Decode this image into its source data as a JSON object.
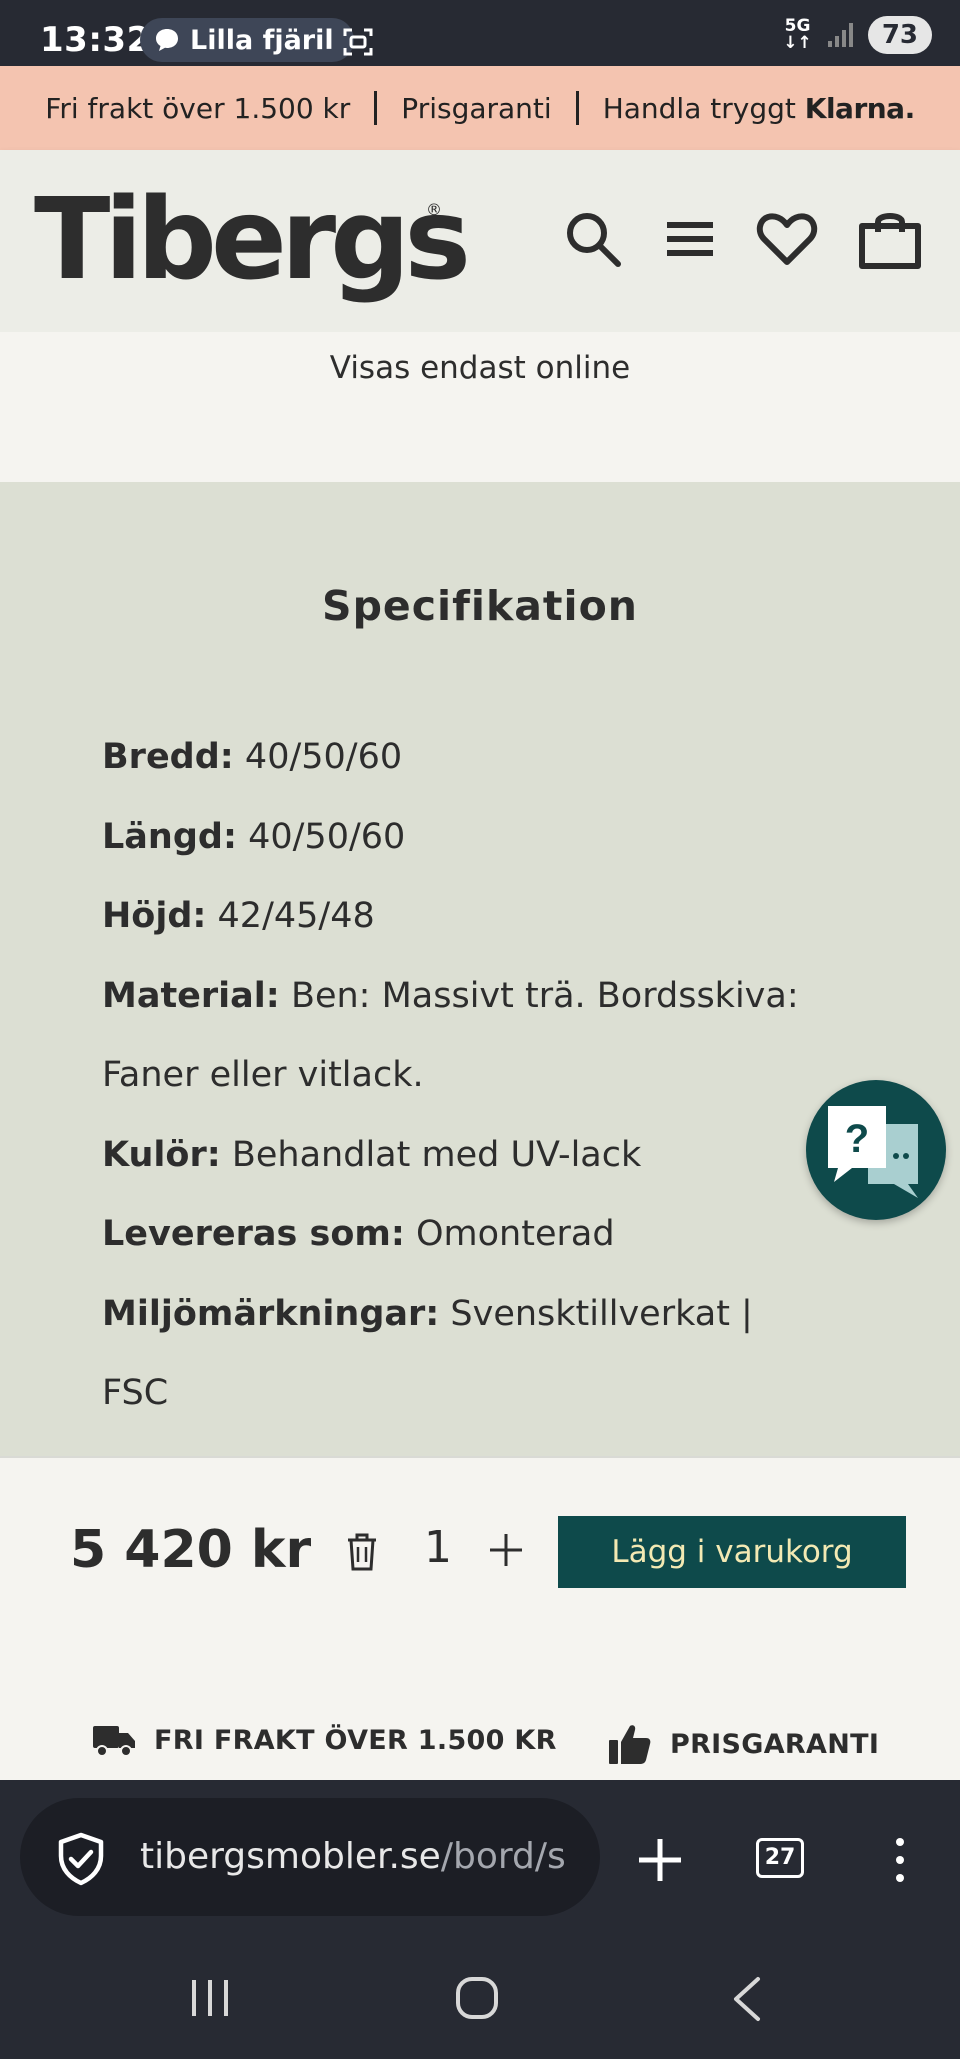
{
  "status_bar": {
    "time": "13:32",
    "notification_label": "Lilla fjäril",
    "network_top": "5G",
    "network_bottom": "↓↑",
    "battery": "73"
  },
  "promo": {
    "item1": "Fri frakt över 1.500 kr",
    "item2": "Prisgaranti",
    "item3": "Handla tryggt",
    "klarna": "Klarna."
  },
  "header": {
    "logo": "Tibergs",
    "icons": [
      "search-icon",
      "menu-icon",
      "heart-icon",
      "cart-icon"
    ]
  },
  "online_notice": "Visas endast online",
  "spec": {
    "title": "Specifikation",
    "items": [
      {
        "label": "Bredd:",
        "value": "40/50/60"
      },
      {
        "label": "Längd:",
        "value": "40/50/60"
      },
      {
        "label": "Höjd:",
        "value": "42/45/48"
      },
      {
        "label": "Material:",
        "value": "Ben: Massivt trä. Bordsskiva: Faner eller vitlack."
      },
      {
        "label": "Kulör:",
        "value": "Behandlat med UV-lack"
      },
      {
        "label": "Levereras som:",
        "value": "Omonterad"
      },
      {
        "label": "Miljömärkningar:",
        "value": "Svensktillverkat | FSC"
      }
    ]
  },
  "purchase": {
    "price": "5 420 kr",
    "quantity": "1",
    "add_to_cart": "Lägg i varukorg"
  },
  "benefits": {
    "shipping": "FRI FRAKT ÖVER 1.500 KR",
    "guarantee": "PRISGARANTI"
  },
  "browser": {
    "url_main": "tibergsmobler.se",
    "url_path": "/bord/s",
    "tab_count": "27"
  },
  "colors": {
    "promo_bg": "#f4c4b0",
    "spec_bg": "#dcdfd3",
    "brand_green": "#0e4a4b",
    "button_text": "#f3e9b3"
  }
}
